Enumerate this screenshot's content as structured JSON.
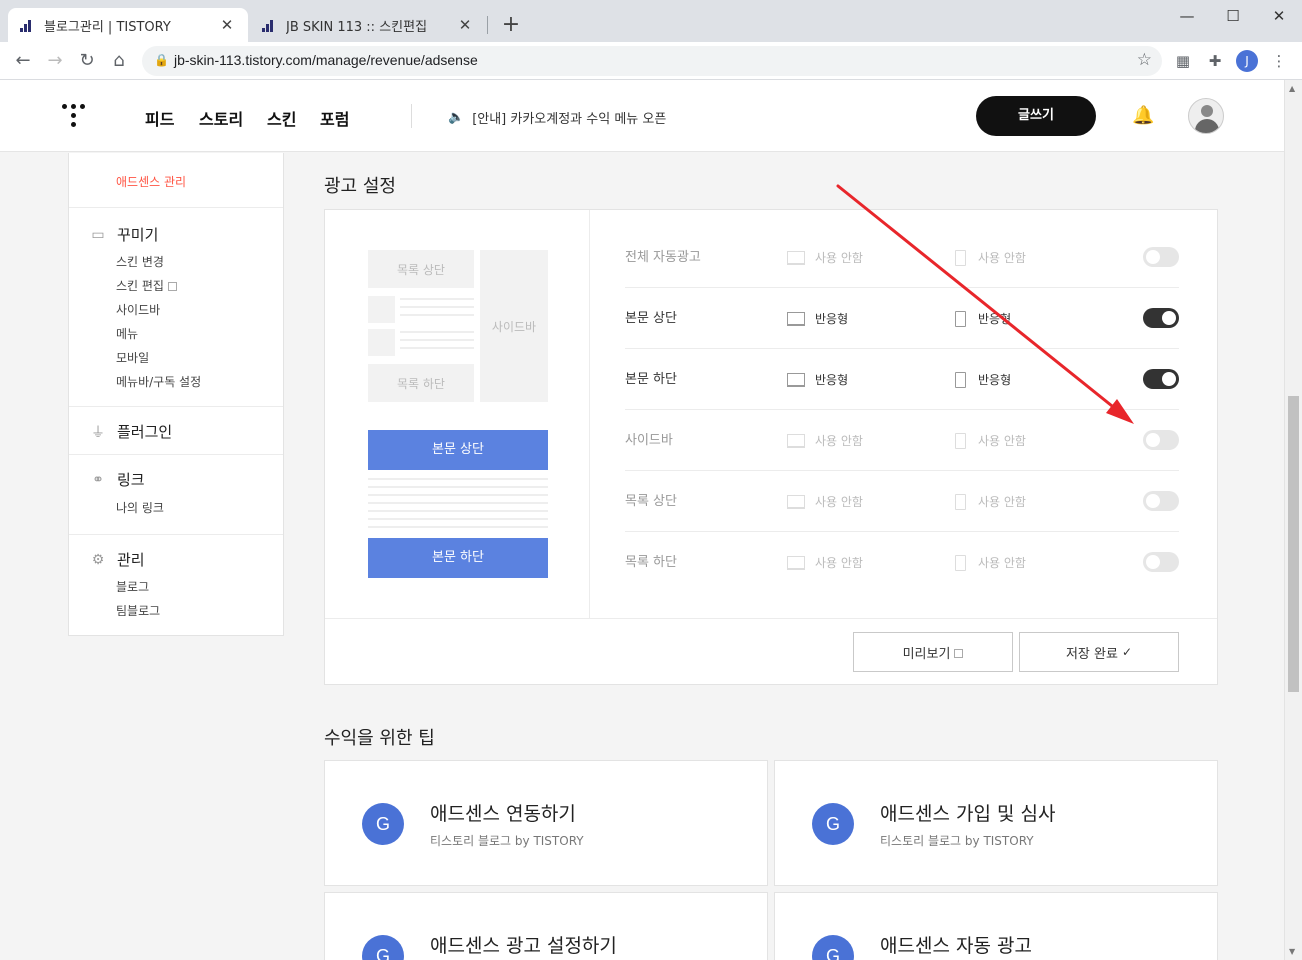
{
  "browser": {
    "tabs": [
      {
        "title": "블로그관리 | TISTORY",
        "active": true
      },
      {
        "title": "JB SKIN 113 :: 스킨편집",
        "active": false
      }
    ],
    "url": "jb-skin-113.tistory.com/manage/revenue/adsense",
    "profile_initial": "J"
  },
  "topnav": {
    "menu": [
      "피드",
      "스토리",
      "스킨",
      "포럼"
    ],
    "notice": "[안내] 카카오계정과 수익 메뉴 오픈",
    "write_label": "글쓰기"
  },
  "sidebar": {
    "top_link": "애드센스 관리",
    "sections": [
      {
        "title": "꾸미기",
        "items": [
          "스킨 변경",
          "스킨 편집",
          "사이드바",
          "메뉴",
          "모바일",
          "메뉴바/구독 설정"
        ]
      },
      {
        "title": "플러그인",
        "items": []
      },
      {
        "title": "링크",
        "items": [
          "나의 링크"
        ]
      },
      {
        "title": "관리",
        "items": [
          "블로그",
          "팀블로그"
        ]
      }
    ]
  },
  "ad_settings": {
    "title": "광고 설정",
    "preview": {
      "list_top": "목록 상단",
      "sidebar": "사이드바",
      "list_bottom": "목록 하단",
      "body_top": "본문 상단",
      "body_bottom": "본문 하단"
    },
    "rows": [
      {
        "label": "전체 자동광고",
        "pc": "사용 안함",
        "mobile": "사용 안함",
        "on": false
      },
      {
        "label": "본문 상단",
        "pc": "반응형",
        "mobile": "반응형",
        "on": true
      },
      {
        "label": "본문 하단",
        "pc": "반응형",
        "mobile": "반응형",
        "on": true
      },
      {
        "label": "사이드바",
        "pc": "사용 안함",
        "mobile": "사용 안함",
        "on": false
      },
      {
        "label": "목록 상단",
        "pc": "사용 안함",
        "mobile": "사용 안함",
        "on": false
      },
      {
        "label": "목록 하단",
        "pc": "사용 안함",
        "mobile": "사용 안함",
        "on": false
      }
    ],
    "preview_button": "미리보기",
    "save_button": "저장 완료"
  },
  "tips": {
    "title": "수익을 위한 팁",
    "cards": [
      {
        "title": "애드센스 연동하기",
        "sub": "티스토리 블로그 by TISTORY",
        "icon": "G"
      },
      {
        "title": "애드센스 가입 및 심사",
        "sub": "티스토리 블로그 by TISTORY",
        "icon": "G"
      },
      {
        "title": "애드센스 광고 설정하기",
        "sub": "",
        "icon": "G"
      },
      {
        "title": "애드센스 자동 광고",
        "sub": "",
        "icon": "G"
      }
    ]
  },
  "colors": {
    "accent": "#5b82e0",
    "active_link": "#ff5544",
    "annotation": "#e8262b"
  }
}
